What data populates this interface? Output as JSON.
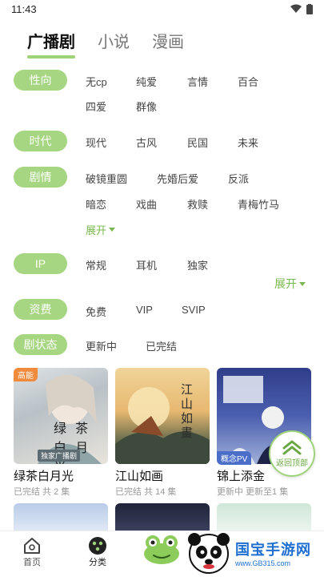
{
  "status": {
    "time": "11:43"
  },
  "tabs": [
    {
      "label": "广播剧",
      "active": true
    },
    {
      "label": "小说",
      "active": false
    },
    {
      "label": "漫画",
      "active": false
    }
  ],
  "filters": {
    "orientation": {
      "label": "性向",
      "options": [
        "无cp",
        "纯爱",
        "言情",
        "百合",
        "四爱",
        "群像"
      ]
    },
    "era": {
      "label": "时代",
      "options": [
        "现代",
        "古风",
        "民国",
        "未来"
      ]
    },
    "plot": {
      "label": "剧情",
      "options": [
        "破镜重圆",
        "先婚后爱",
        "反派",
        "暗恋",
        "戏曲",
        "救赎",
        "青梅竹马"
      ],
      "expand": "展开"
    },
    "ip": {
      "label": "IP",
      "options": [
        "常规",
        "耳机",
        "独家"
      ],
      "expand": "展开"
    },
    "fee": {
      "label": "资费",
      "options": [
        "免费",
        "VIP",
        "SVIP"
      ]
    },
    "status": {
      "label": "剧状态",
      "options": [
        "更新中",
        "已完结"
      ]
    }
  },
  "cards": [
    {
      "title": "绿茶白月光",
      "sub": "已完结 共 2 集",
      "tag": "高能",
      "tag_color": "#f08a3c",
      "cover_text": "绿 茶 白 月 光",
      "cover_sub": "独家广播剧"
    },
    {
      "title": "江山如画",
      "sub": "已完结 共 14 集",
      "cover_text": "江山如畫"
    },
    {
      "title": "锦上添金",
      "sub": "更新中 更新至1 集",
      "tag": "概念PV",
      "tag_color": "#4b6fc9"
    }
  ],
  "back_top": "返回顶部",
  "nav": [
    {
      "label": "首页",
      "icon": "home-icon"
    },
    {
      "label": "分类",
      "icon": "category-icon"
    }
  ],
  "watermark": {
    "text": "国宝手游网",
    "url": "www.GB315.com"
  }
}
